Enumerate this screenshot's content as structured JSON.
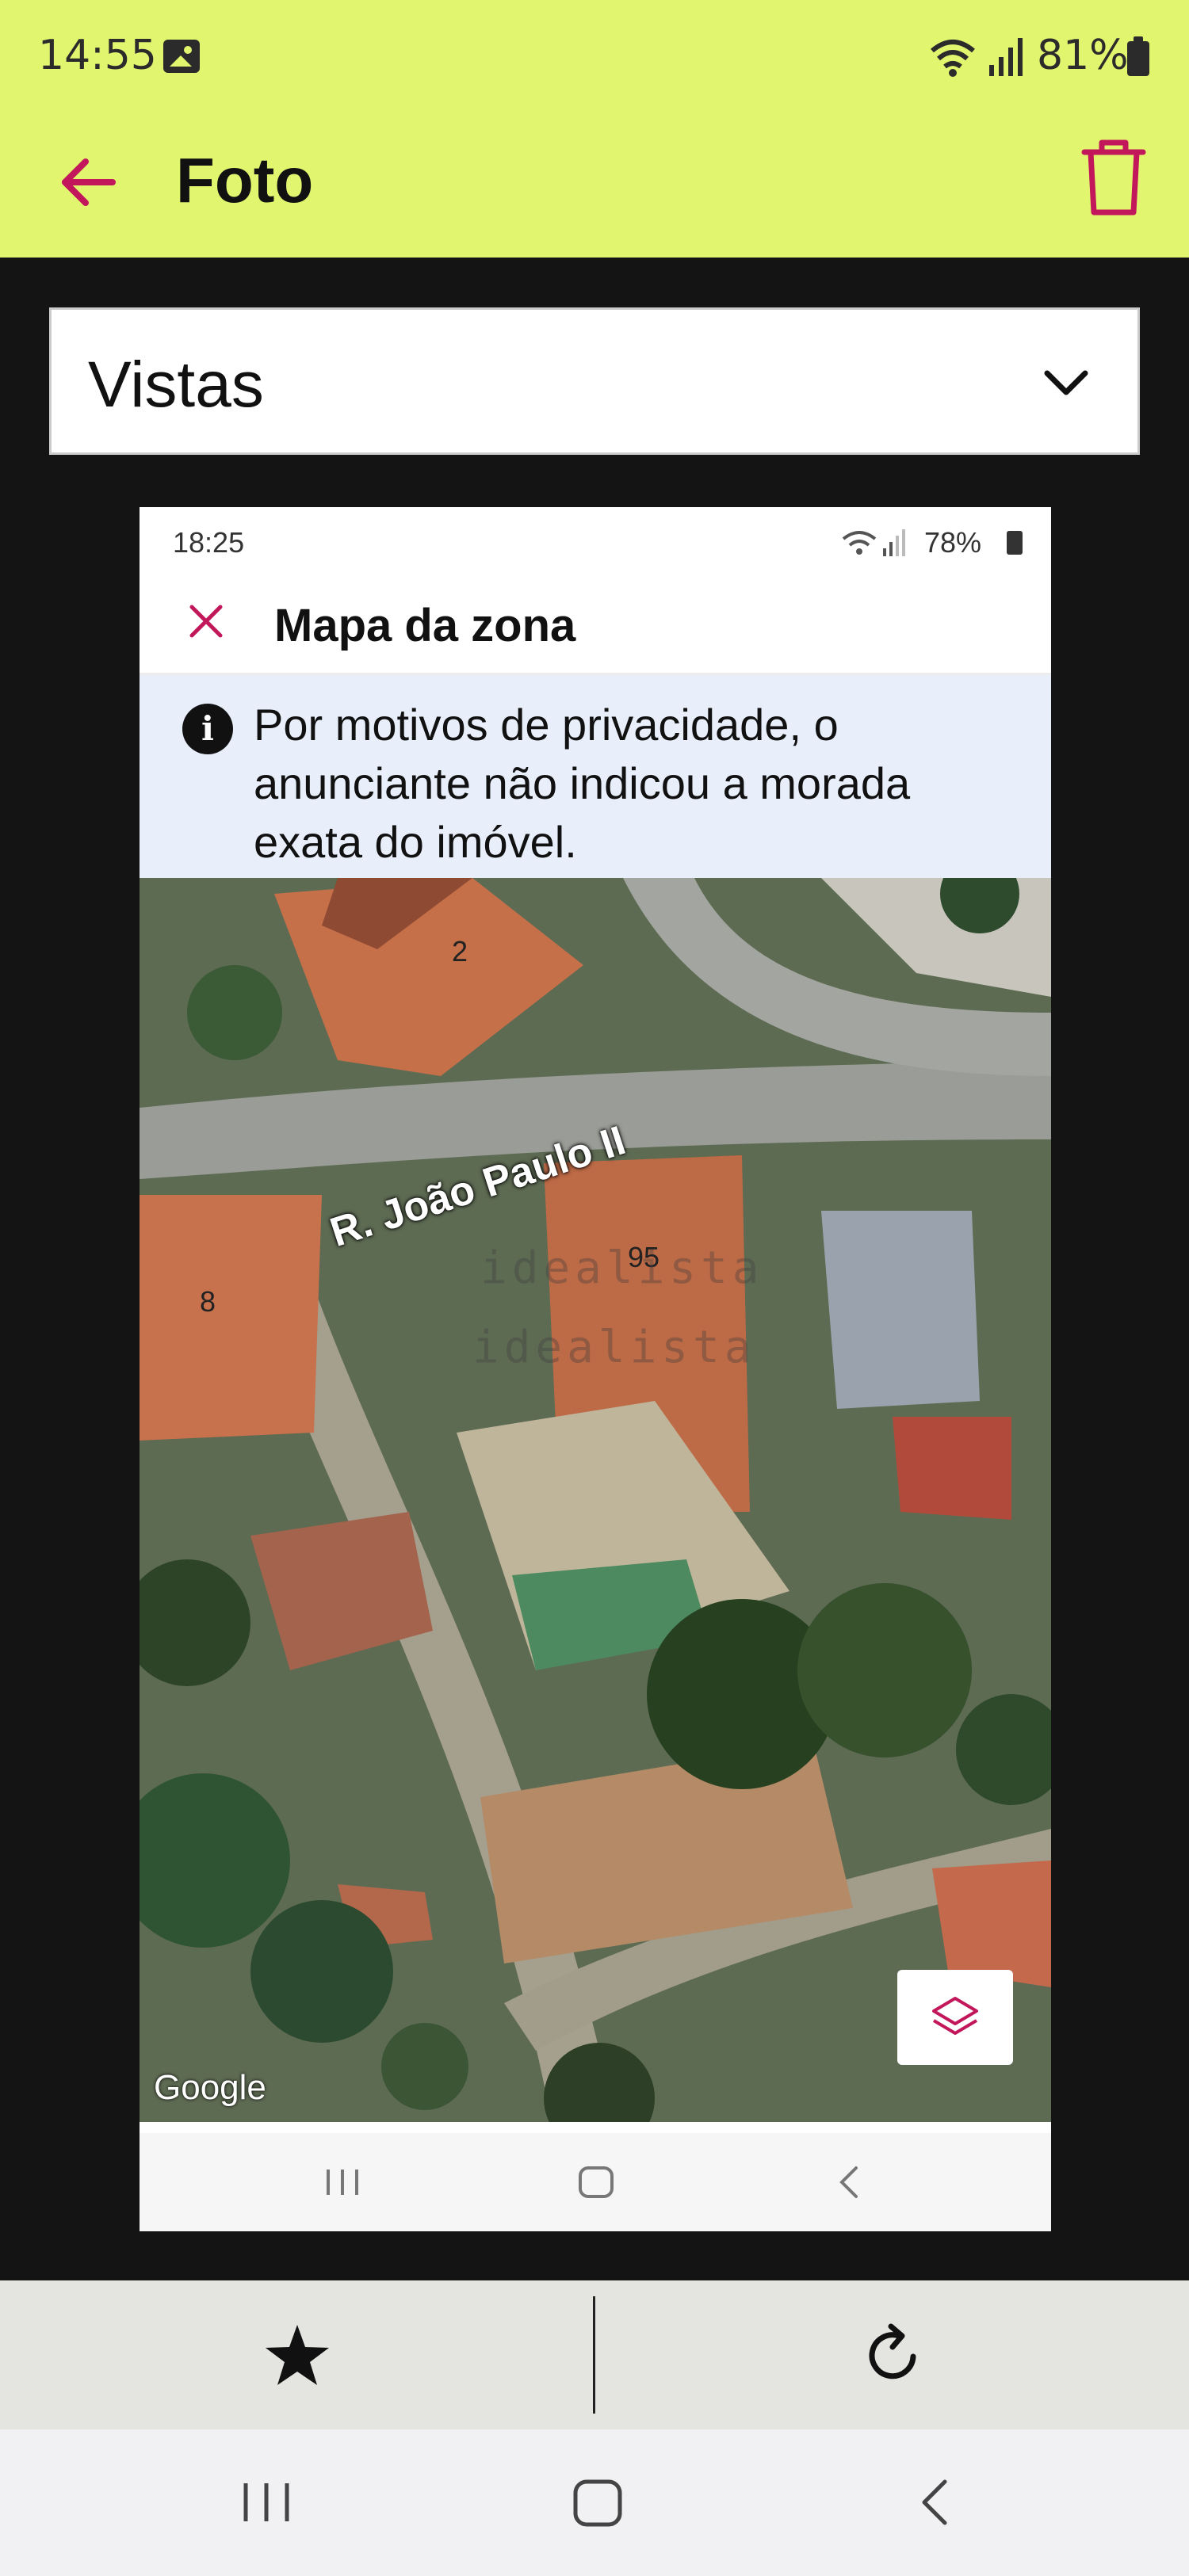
{
  "status_bar": {
    "time": "14:55",
    "battery": "81%",
    "icons": [
      "gallery-icon",
      "wifi-icon",
      "signal-icon",
      "battery-icon"
    ]
  },
  "app_bar": {
    "title": "Foto",
    "back_icon": "arrow-left-icon",
    "delete_icon": "trash-icon",
    "accent": "#c2185b",
    "background": "#e2f56f"
  },
  "category_select": {
    "value": "Vistas",
    "icon": "chevron-down-icon"
  },
  "photo": {
    "status_bar": {
      "time": "18:25",
      "battery": "78%"
    },
    "header": {
      "title": "Mapa da zona",
      "close_icon": "close-icon"
    },
    "notice": {
      "icon": "info-icon",
      "icon_glyph": "i",
      "text": "Por motivos de privacidade, o anunciante não indicou a morada exata do imóvel."
    },
    "map": {
      "street_label": "R. João Paulo II",
      "house_numbers": [
        "2",
        "8",
        "95"
      ],
      "watermark": "idealista",
      "attribution": "Google",
      "layers_icon": "layers-icon"
    },
    "nav_icons": [
      "recent-apps-icon",
      "home-icon",
      "back-icon"
    ]
  },
  "action_bar": {
    "favorite_icon": "star-icon",
    "rotate_icon": "refresh-icon"
  },
  "system_nav": {
    "icons": [
      "recent-apps-icon",
      "home-icon",
      "back-icon"
    ]
  }
}
